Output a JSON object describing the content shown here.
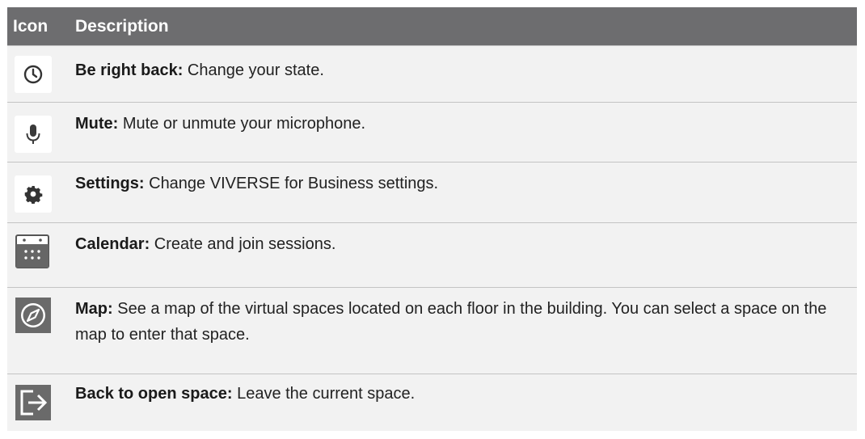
{
  "header": {
    "icon_col": "Icon",
    "desc_col": "Description"
  },
  "rows": [
    {
      "icon": "clock-icon",
      "term": "Be right back:",
      "text": " Change your state."
    },
    {
      "icon": "microphone-icon",
      "term": "Mute:",
      "text": " Mute or unmute your microphone."
    },
    {
      "icon": "gear-icon",
      "term": "Settings:",
      "text": " Change VIVERSE for Business settings."
    },
    {
      "icon": "calendar-icon",
      "term": "Calendar:",
      "text": " Create and join sessions."
    },
    {
      "icon": "compass-icon",
      "term": "Map:",
      "text": " See a map of the virtual spaces located on each floor in the building. You can select a space on the map to enter that space."
    },
    {
      "icon": "exit-arrow-icon",
      "term": "Back to open space:",
      "text": " Leave the current space."
    }
  ]
}
